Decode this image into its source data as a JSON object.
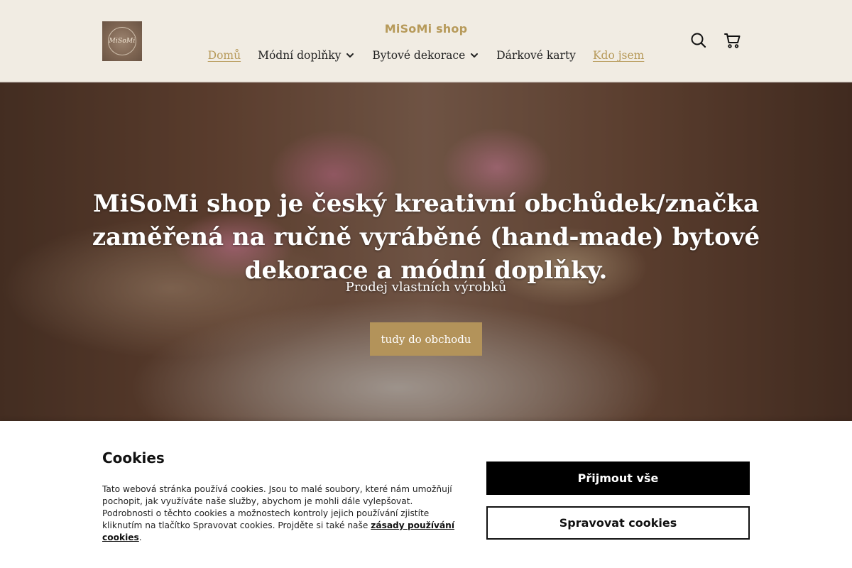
{
  "header": {
    "brand": "MiSoMi shop",
    "logo_text": "MiSoMi",
    "nav": [
      {
        "label": "Domů",
        "active": true,
        "dropdown": false
      },
      {
        "label": "Módní doplňky",
        "active": false,
        "dropdown": true
      },
      {
        "label": "Bytové dekorace",
        "active": false,
        "dropdown": true
      },
      {
        "label": "Dárkové karty",
        "active": false,
        "dropdown": false
      },
      {
        "label": "Kdo jsem",
        "active": true,
        "dropdown": false
      }
    ],
    "icons": [
      "search-icon",
      "cart-icon"
    ]
  },
  "hero": {
    "title": "MiSoMi shop je český kreativní obchůdek/značka zaměřená na ručně vyráběné (hand-made) bytové dekorace a módní doplňky.",
    "subtitle": "Prodej vlastních výrobků",
    "button_label": "tudy do obchodu"
  },
  "cookies": {
    "title": "Cookies",
    "text": "Tato webová stránka používá cookies. Jsou to malé soubory, které nám umožňují pochopit, jak využíváte naše služby, abychom je mohli dále vylepšovat. Podrobnosti o těchto cookies a možnostech kontroly jejich používání zjistíte kliknutím na tlačítko Spravovat cookies. Projděte si také naše ",
    "link_label": "zásady používání cookies",
    "text_end": ".",
    "accept_label": "Přijmout vše",
    "manage_label": "Spravovat cookies"
  },
  "colors": {
    "accent": "#b79a5a",
    "header_bg": "#f1ece3",
    "button_bg": "#b3935a"
  }
}
